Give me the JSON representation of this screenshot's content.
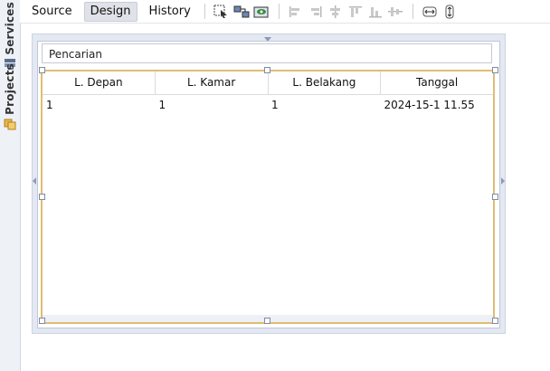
{
  "sidebar": {
    "tabs": [
      {
        "label": "Services",
        "icon": "services-icon"
      },
      {
        "label": "Projects",
        "icon": "projects-icon"
      }
    ]
  },
  "toolbar": {
    "modes": [
      {
        "label": "Source",
        "active": false
      },
      {
        "label": "Design",
        "active": true
      },
      {
        "label": "History",
        "active": false
      }
    ],
    "icons": [
      "selection-mode-icon",
      "connection-mode-icon",
      "preview-design-icon",
      "align-left-icon",
      "align-right-icon",
      "center-horizontal-icon",
      "align-top-icon",
      "align-bottom-icon",
      "center-vertical-icon",
      "resize-horizontal-icon",
      "resize-vertical-icon"
    ]
  },
  "form": {
    "search_label": "Pencarian",
    "table": {
      "columns": [
        "L. Depan",
        "L. Kamar",
        "L. Belakang",
        "Tanggal"
      ],
      "rows": [
        [
          "1",
          "1",
          "1",
          "2024-15-1 11.55"
        ]
      ]
    }
  },
  "colors": {
    "selection_border": "#e0bd73",
    "canvas_bg": "#e4e8f3",
    "active_tab_bg": "#dfe2e8"
  }
}
